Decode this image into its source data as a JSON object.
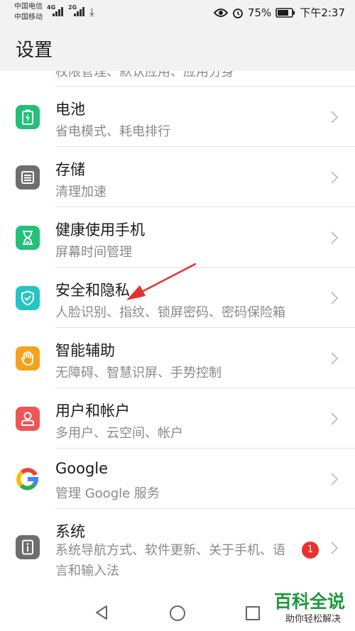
{
  "status_bar": {
    "carrier_1": "中国电信",
    "carrier_2": "中国移动",
    "net_1": "4G",
    "net_2": "2G",
    "battery": "75%",
    "time": "下午2:37"
  },
  "page": {
    "title": "设置"
  },
  "partial_row": {
    "subtitle": "权限管理、默认应用、应用分身"
  },
  "items": [
    {
      "title": "电池",
      "subtitle": "省电模式、耗电排行",
      "icon": "battery-icon",
      "color": "#22c178"
    },
    {
      "title": "存储",
      "subtitle": "清理加速",
      "icon": "storage-icon",
      "color": "#6e6e6e"
    },
    {
      "title": "健康使用手机",
      "subtitle": "屏幕时间管理",
      "icon": "hourglass-icon",
      "color": "#22c178"
    },
    {
      "title": "安全和隐私",
      "subtitle": "人脸识别、指纹、锁屏密码、密码保险箱",
      "icon": "shield-icon",
      "color": "#25c4c4"
    },
    {
      "title": "智能辅助",
      "subtitle": "无障碍、智慧识屏、手势控制",
      "icon": "hand-icon",
      "color": "#f7a11c"
    },
    {
      "title": "用户和帐户",
      "subtitle": "多用户、云空间、帐户",
      "icon": "user-icon",
      "color": "#ee5554"
    },
    {
      "title": "Google",
      "subtitle": "管理 Google 服务",
      "icon": "google-icon",
      "color": "#ffffff"
    },
    {
      "title": "系统",
      "subtitle": "系统导航方式、软件更新、关于手机、语言和输入法",
      "icon": "system-icon",
      "color": "#6e6e6e",
      "badge": "1"
    }
  ],
  "watermark": {
    "main": "百科全说",
    "sub": "助你轻松解决"
  }
}
